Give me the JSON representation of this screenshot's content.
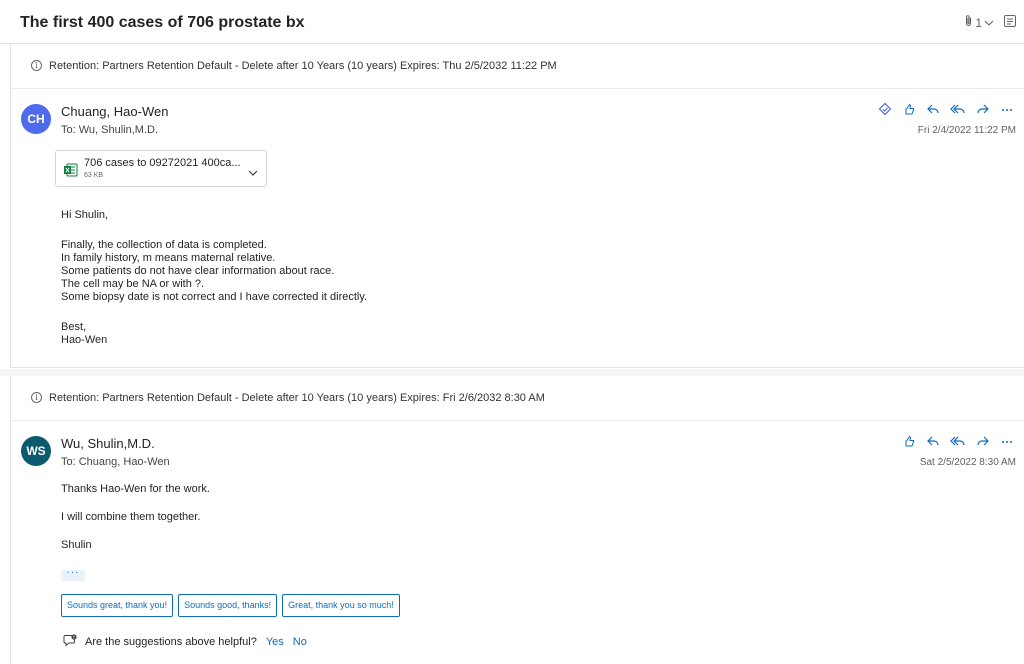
{
  "subject": "The first 400 cases of 706 prostate bx",
  "toolbar": {
    "attachment_count": "1",
    "icons": [
      "paperclip-icon",
      "chevron-down-icon",
      "immersive-reader-icon"
    ]
  },
  "messages": [
    {
      "retention": "Retention: Partners Retention Default - Delete after 10 Years (10 years) Expires: Thu 2/5/2032 11:22 PM",
      "avatar_initials": "CH",
      "avatar_color": "#4f6bed",
      "sender": "Chuang, Hao-Wen",
      "to": "To:  Wu, Shulin,M.D.",
      "date": "Fri 2/4/2022 11:22 PM",
      "actions": [
        "loop-icon",
        "like-icon",
        "reply-icon",
        "reply-all-icon",
        "forward-icon",
        "more-icon"
      ],
      "attachment": {
        "name": "706 cases to 09272021 400ca...",
        "size": "63 KB",
        "icon": "excel-icon"
      },
      "body": {
        "greeting": "Hi Shulin,",
        "lines": [
          "Finally, the collection of data is completed.",
          "In family history, m means maternal relative.",
          "Some patients do not have clear information about race.",
          "The cell may be NA or with ?.",
          "Some biopsy date is not correct and I have corrected it directly."
        ],
        "signoff": "Best,",
        "signature": "Hao-Wen"
      }
    },
    {
      "retention": "Retention: Partners Retention Default - Delete after 10 Years (10 years) Expires: Fri 2/6/2032 8:30 AM",
      "avatar_initials": "WS",
      "avatar_color": "#0b5a6e",
      "sender": "Wu, Shulin,M.D.",
      "to": "To:  Chuang, Hao-Wen",
      "date": "Sat 2/5/2022 8:30 AM",
      "actions": [
        "like-icon",
        "reply-icon",
        "reply-all-icon",
        "forward-icon",
        "more-icon"
      ],
      "body": {
        "lines": [
          "Thanks Hao-Wen for the work.",
          "I will combine them together.",
          "Shulin"
        ]
      },
      "more_label": "···",
      "suggested_replies": [
        "Sounds great, thank you!",
        "Sounds good, thanks!",
        "Great, thank you so much!"
      ],
      "feedback": {
        "question": "Are the suggestions above helpful?",
        "yes": "Yes",
        "no": "No"
      }
    }
  ],
  "colors": {
    "accent": "#0f6cbd",
    "border": "#e1e1e1"
  }
}
